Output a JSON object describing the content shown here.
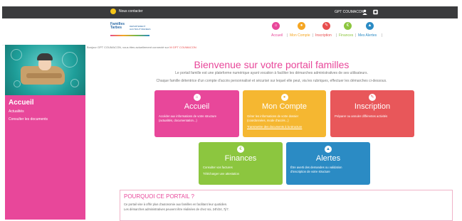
{
  "topbar": {
    "contact_label": "Nous contacter",
    "user_label": "GPT COUMACON"
  },
  "header": {
    "logo": {
      "line1": "Familles Tarbes",
      "line2": "DEPARTEMENT HAUTES-PYRENEES"
    },
    "nav": [
      {
        "label": "Accueil",
        "color": "#e8479a"
      },
      {
        "label": "Mon Compte",
        "color": "#f5a623"
      },
      {
        "label": "Inscription",
        "color": "#e84d4d"
      },
      {
        "label": "Finances",
        "color": "#8cc63f"
      },
      {
        "label": "Mes Alertes",
        "color": "#2b8bc4"
      }
    ]
  },
  "sidebar": {
    "title": "Accueil",
    "links": [
      "Actualités",
      "Consulter les documents"
    ]
  },
  "main": {
    "greeting": "Bonjour GPT COUMACON, vous êtes actuellement connecté sur",
    "greeting_name": "M GPT COUMACON",
    "welcome": "Bienvenue sur votre portail familles",
    "intro1": "Le portail famille est une plateforme numérique ayant vocation à faciliter les démarches administratives de ses utilisateurs.",
    "intro2": "Chaque famille détentrice d'un compte d'accès personnalisé et sécurisé sur lequel elle peut, via les rubriques, effectuer les démarches ci-dessous.",
    "cards": [
      {
        "key": "accueil",
        "title": "Accueil",
        "color": "#e8479a",
        "icon": "home-icon",
        "desc": [
          "Accéder aux informations de votre structure",
          "(actualités, documentation...)"
        ]
      },
      {
        "key": "compte",
        "title": "Mon Compte",
        "color": "#f5b731",
        "icon": "user-icon",
        "desc": [
          "Gérer les informations de votre dossier",
          "(coordonnées, mode d'accès...)",
          "Transmettre des documents à la structure"
        ]
      },
      {
        "key": "inscription",
        "title": "Inscription",
        "color": "#e8575a",
        "icon": "pencil-icon",
        "desc": [
          "Préparer ou annuler différentes activités"
        ]
      },
      {
        "key": "finances",
        "title": "Finances",
        "color": "#8cc63f",
        "icon": "euro-icon",
        "desc": [
          "Consulter vos factures",
          "Télécharger une attestation"
        ]
      },
      {
        "key": "alertes",
        "title": "Alertes",
        "color": "#2b8bc4",
        "icon": "bell-icon",
        "desc": [
          "Être averti des demandes ou validation",
          "d'inscription de votre structure"
        ]
      }
    ],
    "why": {
      "title": "POURQUOI CE PORTAIL ?",
      "lines": [
        "Ce portail vise à offrir plus d'autonomie aux familles en facilitant leur quotidien.",
        "Les démarches administratives peuvent être réalisées de chez soi, 24h/24, 7j/7."
      ]
    }
  }
}
